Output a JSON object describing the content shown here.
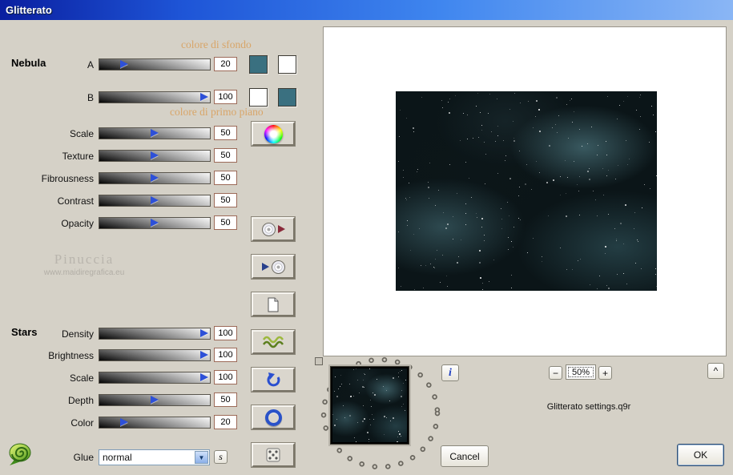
{
  "window": {
    "title": "Glitterato"
  },
  "nebula": {
    "section_label": "Nebula",
    "background_color_label": "colore di sfondo",
    "foreground_color_label": "colore di primo piano",
    "swatches_a": [
      "#3a7080",
      "#ffffff"
    ],
    "swatches_b": [
      "#ffffff",
      "#3a7080"
    ],
    "sliders": [
      {
        "label": "A",
        "value": "20"
      },
      {
        "label": "B",
        "value": "100"
      },
      {
        "label": "Scale",
        "value": "50"
      },
      {
        "label": "Texture",
        "value": "50"
      },
      {
        "label": "Fibrousness",
        "value": "50"
      },
      {
        "label": "Contrast",
        "value": "50"
      },
      {
        "label": "Opacity",
        "value": "50"
      }
    ]
  },
  "stars": {
    "section_label": "Stars",
    "sliders": [
      {
        "label": "Density",
        "value": "100"
      },
      {
        "label": "Brightness",
        "value": "100"
      },
      {
        "label": "Scale",
        "value": "100"
      },
      {
        "label": "Depth",
        "value": "50"
      },
      {
        "label": "Color",
        "value": "20"
      }
    ]
  },
  "glue": {
    "label": "Glue",
    "value": "normal"
  },
  "watermark": {
    "name": "Pinuccia",
    "url": "www.maidiregrafica.eu"
  },
  "zoom": {
    "minus": "−",
    "level": "50%",
    "plus": "+"
  },
  "footer": {
    "settings_file": "Glitterato settings.q9r",
    "cancel": "Cancel",
    "ok": "OK",
    "info": "i",
    "caret": "^",
    "s_button": "s"
  },
  "icons": {
    "color_wheel": "rainbow-color-wheel",
    "cd_play": "disc-with-play-arrow",
    "play_cd": "play-arrow-with-disc",
    "page": "document-page",
    "waves": "green-waves",
    "undo": "undo-arrow",
    "ring": "blue-ring",
    "dice": "die-face-5",
    "shell": "green-spiral-shell",
    "combo_arrow": "▼"
  }
}
